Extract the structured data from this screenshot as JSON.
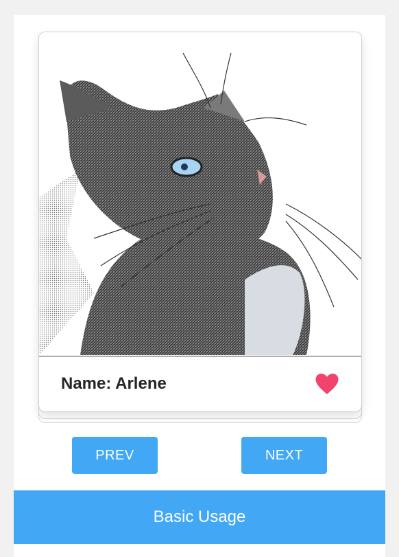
{
  "card": {
    "name_label": "Name: Arlene",
    "photo_icon": "cat-photo",
    "favorite_icon": "heart-icon",
    "favorite_color": "#f0446e"
  },
  "controls": {
    "prev_label": "PREV",
    "next_label": "NEXT",
    "button_color": "#42a8f5"
  },
  "footer": {
    "title": "Basic Usage"
  }
}
